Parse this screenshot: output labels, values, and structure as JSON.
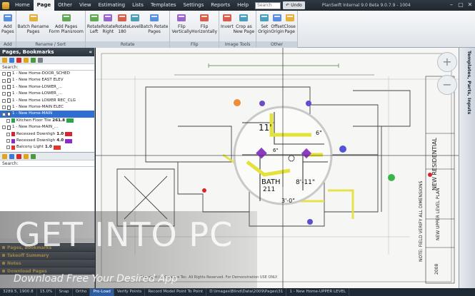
{
  "app": {
    "title": "PlanSwift Internal 9.0 Beta 9.0.7.9 - 1004",
    "menu": [
      "Home",
      "Page",
      "Other",
      "View",
      "Estimating",
      "Lists",
      "Templates",
      "Settings",
      "Reports",
      "Help"
    ],
    "active_menu": "Page",
    "search_placeholder": "Search",
    "undo_label": "Undo"
  },
  "ribbon": {
    "groups": [
      {
        "label": "Add",
        "buttons": [
          {
            "l1": "Add",
            "l2": "Pages",
            "icon": "add-pages-icon"
          }
        ]
      },
      {
        "label": "Rename / Sort",
        "buttons": [
          {
            "l1": "Batch Rename",
            "l2": "Pages",
            "icon": "batch-rename-icon"
          },
          {
            "l1": "Add Pages",
            "l2": "Form Plansroom",
            "icon": "add-pages-form-icon"
          }
        ]
      },
      {
        "label": "Rotate",
        "buttons": [
          {
            "l1": "Rotate",
            "l2": "Left",
            "icon": "rotate-left-icon"
          },
          {
            "l1": "Rotate",
            "l2": "Right",
            "icon": "rotate-right-icon"
          },
          {
            "l1": "Rotate",
            "l2": "180",
            "icon": "rotate-180-icon"
          },
          {
            "l1": "Level",
            "l2": "",
            "icon": "level-icon"
          },
          {
            "l1": "Batch Rotate",
            "l2": "Pages",
            "icon": "batch-rotate-icon"
          }
        ]
      },
      {
        "label": "Flip",
        "buttons": [
          {
            "l1": "Flip",
            "l2": "Vertically",
            "icon": "flip-vertical-icon"
          },
          {
            "l1": "Flip",
            "l2": "Horizontally",
            "icon": "flip-horizontal-icon"
          }
        ]
      },
      {
        "label": "Image Tools",
        "buttons": [
          {
            "l1": "Invert",
            "l2": "",
            "icon": "invert-icon"
          },
          {
            "l1": "Crop as",
            "l2": "New Page",
            "icon": "crop-icon"
          }
        ]
      },
      {
        "label": "Other",
        "buttons": [
          {
            "l1": "Set",
            "l2": "Origin",
            "icon": "set-origin-icon"
          },
          {
            "l1": "Offset",
            "l2": "Origin",
            "icon": "offset-origin-icon"
          },
          {
            "l1": "Close",
            "l2": "Page",
            "icon": "close-page-icon"
          }
        ]
      }
    ]
  },
  "left_panel": {
    "title": "Pages, Bookmarks",
    "search_label": "Search:",
    "tree": [
      {
        "label": "1 - New Home-DOOR_SCHED",
        "selected": false,
        "kind": "page"
      },
      {
        "label": "1 - New Home EAST ELEV",
        "selected": false,
        "kind": "page"
      },
      {
        "label": "1 - New Home-LOWER_...",
        "selected": false,
        "kind": "page"
      },
      {
        "label": "1 - New Home-LOWER_...",
        "selected": false,
        "kind": "page"
      },
      {
        "label": "1 - New Home LOWER REC_CLG",
        "selected": false,
        "kind": "page"
      },
      {
        "label": "1 - New Home-MAIN ELEC",
        "selected": false,
        "kind": "page"
      },
      {
        "label": "1 - New Home-MAIN",
        "selected": true,
        "kind": "page"
      },
      {
        "label": "Kitchen Floor Tile",
        "selected": false,
        "kind": "item",
        "value": "261.8",
        "color": "#2fa34a"
      },
      {
        "label": "1 - New Home-MAIN_...",
        "selected": false,
        "kind": "page"
      },
      {
        "label": "Recessed Downligh",
        "selected": false,
        "kind": "item",
        "value": "1.0",
        "color": "#d8262e"
      },
      {
        "label": "Recessed Downligh",
        "selected": false,
        "kind": "item",
        "value": "4.0",
        "color": "#8a2bd1"
      },
      {
        "label": "Balcony Light",
        "selected": false,
        "kind": "item",
        "value": "1.0",
        "color": "#e0352b"
      }
    ],
    "accordions": [
      "Pages, Bookmarks",
      "Takeoff Summary",
      "Notes",
      "Download Pages"
    ]
  },
  "drawing": {
    "title_block": [
      "NEW RESIDENTIAL",
      "NEW UPPER LEVEL PLAN",
      "NOTE: FIELD VERIFY ALL DIMENSIONS",
      "2008"
    ],
    "magnifier_labels": [
      "11'",
      "BATH",
      "211",
      "8'-11\"",
      "6\"",
      "6\"",
      "3'-0\""
    ],
    "copyright": "Copyright (c) Creative Tec. All Rights Reserved. For Demonstration USE ONLY."
  },
  "right_panel": {
    "tab": "Templates, Parts, Inputs"
  },
  "status_bar": {
    "segments": [
      "3289.5, 1900.8",
      "15.0%",
      "Snap",
      "Ortho",
      "Pro-Load",
      "Verify Points",
      "Record Model Point To Point",
      "D:\\Images\\Blind\\Data\\2009\\Pages\\31",
      "1 - New Home-UPPER LEVEL"
    ],
    "active_segment": "Pro-Load"
  },
  "watermark": {
    "title": "GET INTO PC",
    "subtitle": "Download Free Your Desired App"
  }
}
